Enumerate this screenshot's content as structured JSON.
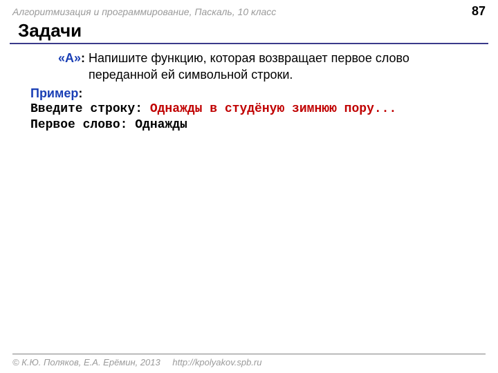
{
  "header": {
    "breadcrumb": "Алгоритмизация и программирование, Паскаль, 10 класс",
    "page_number": "87"
  },
  "title": "Задачи",
  "task": {
    "label": "«A»",
    "colon": ":",
    "text": " Напишите функцию, которая возвращает первое слово переданной ей символьной строки."
  },
  "example": {
    "label": "Пример",
    "colon": ":",
    "line1_prompt": "Введите строку: ",
    "line1_input": "Однажды в студёную зимнюю пору...",
    "line2": "Первое слово: Однажды"
  },
  "footer": {
    "copyright": "© К.Ю. Поляков, Е.А. Ерёмин, 2013",
    "url": "http://kpolyakov.spb.ru"
  }
}
